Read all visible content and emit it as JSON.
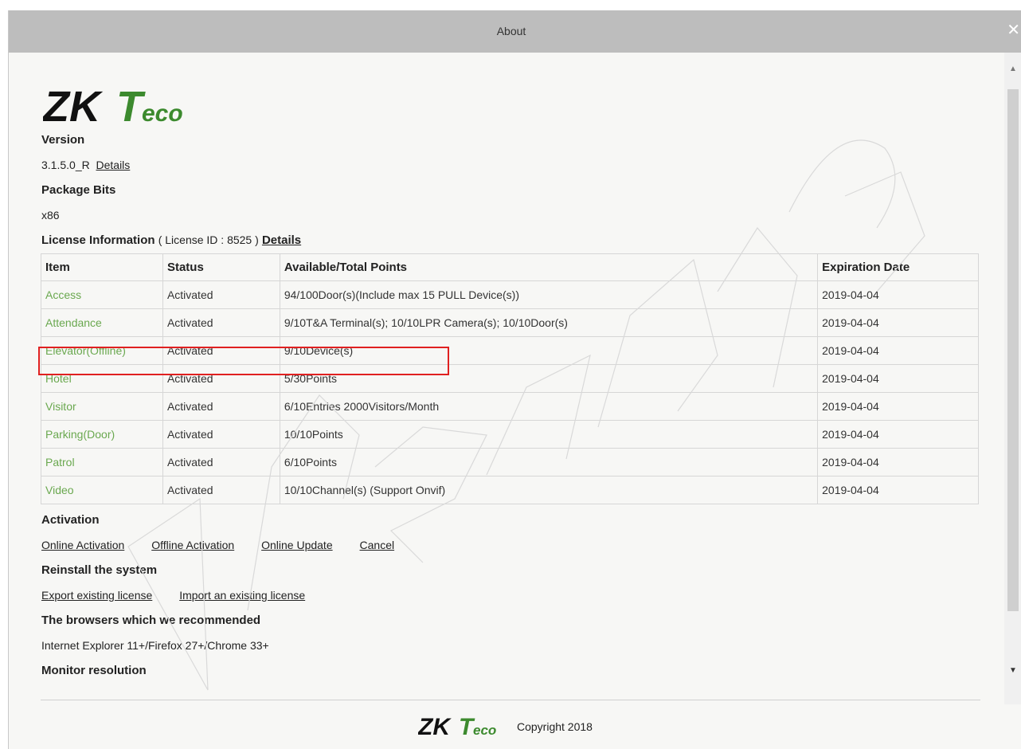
{
  "window": {
    "title": "About",
    "close_glyph": "✕"
  },
  "logo": {
    "brand_zk": "ZK",
    "brand_teco_t": "T",
    "brand_teco_rest": "eco",
    "logo_color_dark": "#111111",
    "logo_color_green": "#3c8a2e"
  },
  "version": {
    "heading": "Version",
    "value": "3.1.5.0_R",
    "details_link": "Details"
  },
  "package_bits": {
    "heading": "Package Bits",
    "value": "x86"
  },
  "license": {
    "heading": "License Information",
    "license_id_text": "( License ID : 8525 )",
    "details_link": "Details",
    "columns": [
      "Item",
      "Status",
      "Available/Total Points",
      "Expiration Date"
    ],
    "rows": [
      {
        "item": "Access",
        "status": "Activated",
        "points": "94/100Door(s)(Include max 15 PULL Device(s))",
        "expiration": "2019-04-04"
      },
      {
        "item": "Attendance",
        "status": "Activated",
        "points": "9/10T&A Terminal(s); 10/10LPR Camera(s); 10/10Door(s)",
        "expiration": "2019-04-04"
      },
      {
        "item": "Elevator(Offline)",
        "status": "Activated",
        "points": "9/10Device(s)",
        "expiration": "2019-04-04"
      },
      {
        "item": "Hotel",
        "status": "Activated",
        "points": "5/30Points",
        "expiration": "2019-04-04"
      },
      {
        "item": "Visitor",
        "status": "Activated",
        "points": "6/10Entries 2000Visitors/Month",
        "expiration": "2019-04-04"
      },
      {
        "item": "Parking(Door)",
        "status": "Activated",
        "points": "10/10Points",
        "expiration": "2019-04-04"
      },
      {
        "item": "Patrol",
        "status": "Activated",
        "points": "6/10Points",
        "expiration": "2019-04-04"
      },
      {
        "item": "Video",
        "status": "Activated",
        "points": "10/10Channel(s) (Support Onvif)",
        "expiration": "2019-04-04"
      }
    ],
    "item_color": "#6aa84f"
  },
  "activation": {
    "heading": "Activation",
    "links": [
      "Online Activation",
      "Offline Activation",
      "Online Update",
      "Cancel"
    ]
  },
  "reinstall": {
    "heading": "Reinstall the system",
    "links": [
      "Export existing license",
      "Import an existing license"
    ]
  },
  "browsers": {
    "heading": "The browsers which we recommended",
    "value": "Internet Explorer 11+/Firefox 27+/Chrome 33+"
  },
  "monitor": {
    "heading": "Monitor resolution"
  },
  "footer": {
    "copyright": "Copyright 2018"
  },
  "highlight_color": "#e02020"
}
